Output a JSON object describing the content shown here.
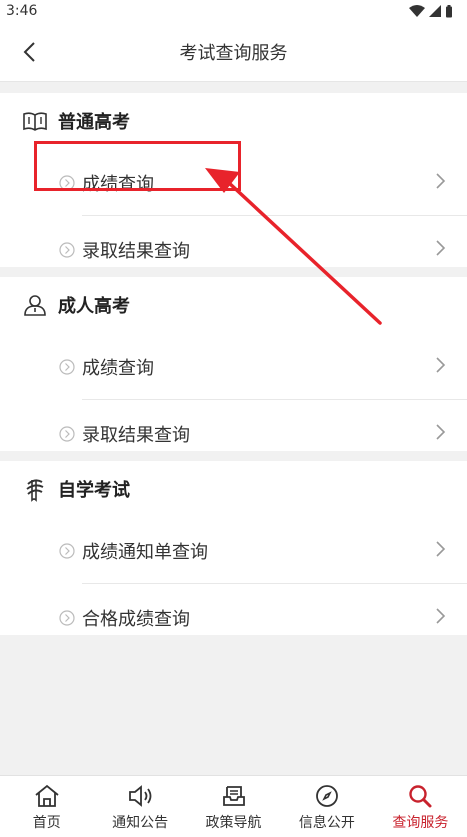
{
  "status_bar": {
    "time": "3:46"
  },
  "header": {
    "title": "考试查询服务"
  },
  "sections": [
    {
      "title": "普通高考",
      "icon": "book-icon",
      "items": [
        {
          "label": "成绩查询"
        },
        {
          "label": "录取结果查询"
        }
      ]
    },
    {
      "title": "成人高考",
      "icon": "person-icon",
      "items": [
        {
          "label": "成绩查询"
        },
        {
          "label": "录取结果查询"
        }
      ]
    },
    {
      "title": "自学考试",
      "icon": "scroll-icon",
      "items": [
        {
          "label": "成绩通知单查询"
        },
        {
          "label": "合格成绩查询"
        }
      ]
    }
  ],
  "tabs": [
    {
      "label": "首页",
      "icon": "home-icon"
    },
    {
      "label": "通知公告",
      "icon": "speaker-icon"
    },
    {
      "label": "政策导航",
      "icon": "inbox-icon"
    },
    {
      "label": "信息公开",
      "icon": "compass-icon"
    },
    {
      "label": "查询服务",
      "icon": "search-icon",
      "active": true
    }
  ],
  "colors": {
    "accent": "#c8222d",
    "annotation": "#e8232b"
  }
}
